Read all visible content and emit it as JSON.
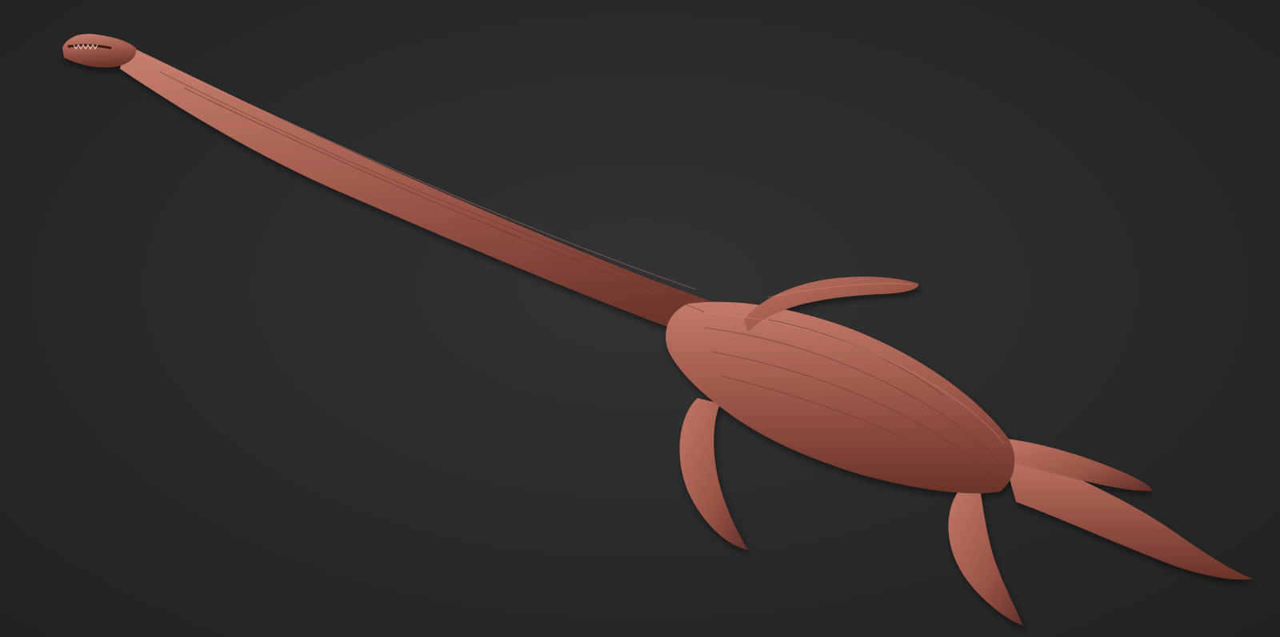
{
  "scene": {
    "subject": "sculpted-plesiosaur-model",
    "colors": {
      "background": "#2b2b2b",
      "background_dark": "#222222",
      "clay_base": "#9b5246",
      "clay_light": "#c27a6b",
      "clay_shadow": "#5e2c24"
    }
  }
}
